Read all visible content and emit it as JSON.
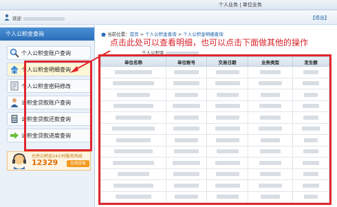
{
  "topnav": {
    "label": "个人业务 | 单位业务"
  },
  "userbar": {
    "welcome": "欢迎",
    "exit": "【退出】"
  },
  "sidebar": {
    "title": "个人公积金查询",
    "items": [
      {
        "label": "个人公积金账户查询",
        "icon": "magnifier-icon"
      },
      {
        "label": "个人公积金明细查询",
        "icon": "house-icon"
      },
      {
        "label": "个人公积金密码修改",
        "icon": "document-icon"
      },
      {
        "label": "公积金贷款账户查询",
        "icon": "person-icon"
      },
      {
        "label": "公积金贷款还款查询",
        "icon": "calculator-icon"
      },
      {
        "label": "公积金贷款进度查询",
        "icon": "arrow-right-icon"
      }
    ],
    "hotline": {
      "caption": "住房公积金24小时服务热线",
      "number": "12329",
      "button": "在线咨询"
    }
  },
  "breadcrumb": {
    "label": "当前位置：",
    "home": "首页",
    "sep1": " > ",
    "level1": "个人公积金查询",
    "sep2": " > ",
    "level2": "个人公积金明细查询"
  },
  "annotation": {
    "text": "点击此处可以查看明细，也可以点击下面做其他的操作"
  },
  "subtitle": {
    "prefix": "个人公积金"
  },
  "table": {
    "headers": [
      "单位名称",
      "单位账号",
      "交易日期",
      "业务类型",
      "发生额"
    ],
    "row_count": 12
  },
  "colors": {
    "highlight": "#e0262c",
    "header_blue": "#2c6fb9",
    "annotation": "#d9222a"
  }
}
